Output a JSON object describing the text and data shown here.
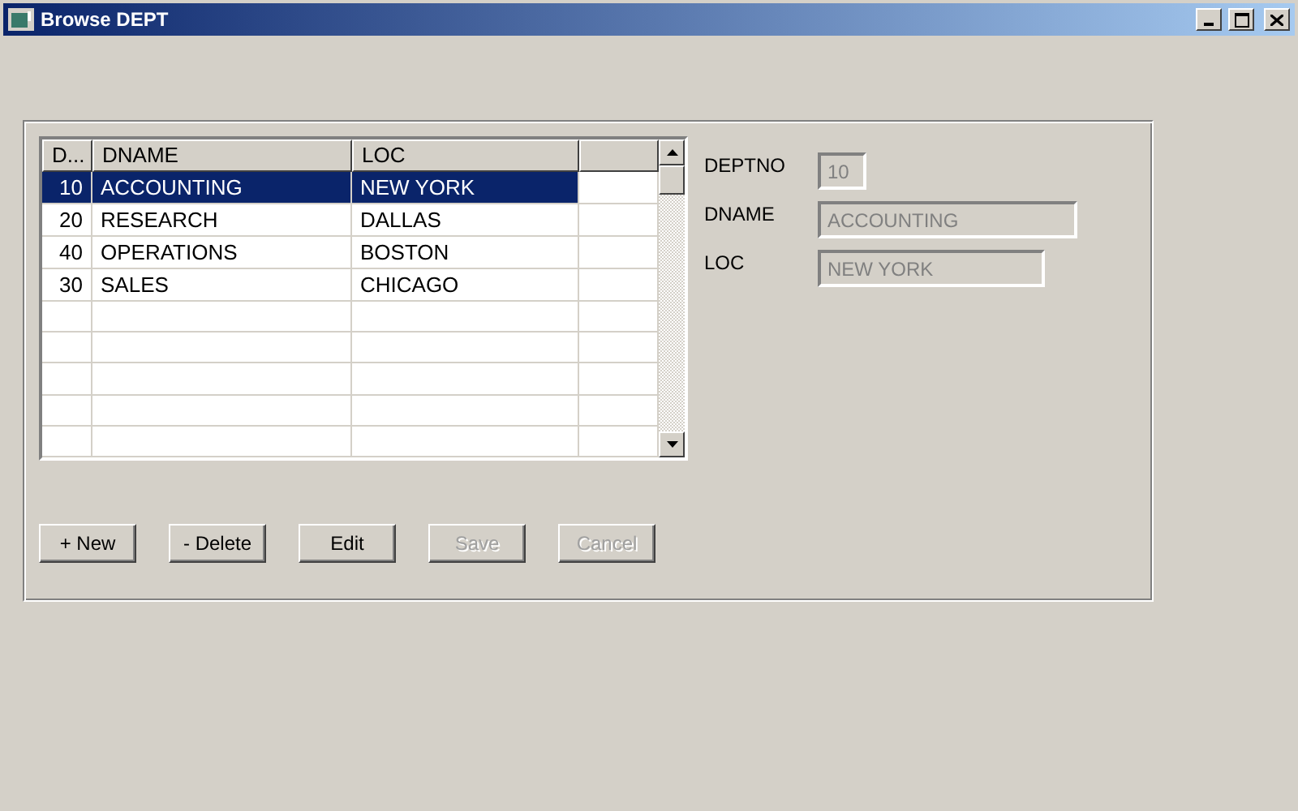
{
  "window": {
    "title": "Browse DEPT",
    "controls": [
      {
        "kind": "minimize"
      },
      {
        "kind": "maximize"
      },
      {
        "kind": "close"
      }
    ]
  },
  "grid": {
    "columns": [
      "D...",
      "DNAME",
      "LOC"
    ],
    "rows": [
      {
        "cells": [
          "10",
          "ACCOUNTING",
          "NEW YORK"
        ],
        "selected": true
      },
      {
        "cells": [
          "20",
          "RESEARCH",
          "DALLAS"
        ],
        "selected": false
      },
      {
        "cells": [
          "40",
          "OPERATIONS",
          "BOSTON"
        ],
        "selected": false
      },
      {
        "cells": [
          "30",
          "SALES",
          "CHICAGO"
        ],
        "selected": false
      }
    ]
  },
  "fields": [
    {
      "label": "DEPTNO",
      "value": "10",
      "disabled": true
    },
    {
      "label": "DNAME",
      "value": "ACCOUNTING",
      "disabled": true
    },
    {
      "label": "LOC",
      "value": "NEW YORK",
      "disabled": true
    }
  ],
  "buttons": [
    {
      "label": "+ New",
      "disabled": false
    },
    {
      "label": "- Delete",
      "disabled": false
    },
    {
      "label": "Edit",
      "disabled": false
    },
    {
      "label": "Save",
      "disabled": true
    },
    {
      "label": "Cancel",
      "disabled": true
    }
  ]
}
